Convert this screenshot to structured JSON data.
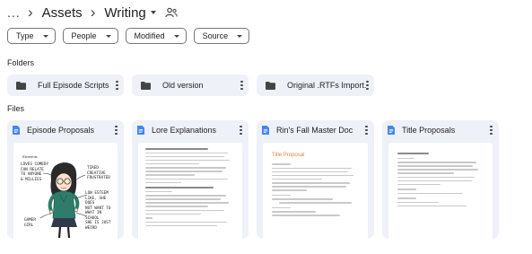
{
  "breadcrumb": {
    "overflow": "...",
    "items": [
      "Assets",
      "Writing"
    ]
  },
  "filters": [
    "Type",
    "People",
    "Modified",
    "Source"
  ],
  "sections": {
    "folders": "Folders",
    "files": "Files"
  },
  "folders": [
    {
      "name": "Full Episode Scripts"
    },
    {
      "name": "Old version"
    },
    {
      "name": "Original .RTFs Import..."
    }
  ],
  "files": [
    {
      "name": "Episode Proposals",
      "thumb_heading": "Elements"
    },
    {
      "name": "Lore Explanations"
    },
    {
      "name": "Rin's Fall Master Doc",
      "thumb_heading": "Title Proposal"
    },
    {
      "name": "Title Proposals"
    }
  ],
  "sketch_notes": [
    "LOVES COMEDY",
    "CAN RELATE",
    "TO ANYONE",
    "& MILLIES",
    "TIRED",
    "CREATIVE",
    "FRUSTRATED",
    "LOW ESTEEM",
    "LIKE, SHE DOES",
    "NOT WANT TO",
    "WHAT IN SCHOOL",
    "SHE IS JUST",
    "WEIRD",
    "GAMER",
    "GIRL"
  ],
  "colors": {
    "accent_doc": "#4285f4",
    "card_bg": "#eef1f7",
    "chip_border": "#747775",
    "heading_orange": "#e6853a",
    "sketch_green": "#2e7d6b"
  }
}
